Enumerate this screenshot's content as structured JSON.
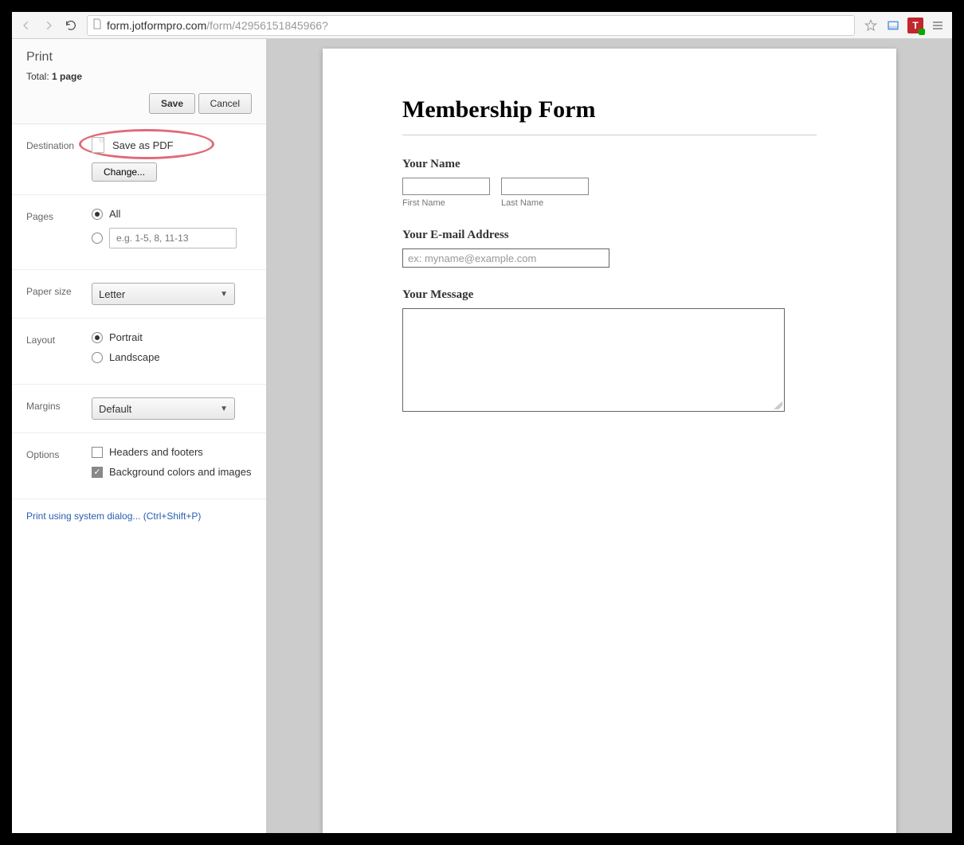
{
  "browser": {
    "url_host": "form.jotformpro.com",
    "url_path": "/form/42956151845966?"
  },
  "print": {
    "title": "Print",
    "total_prefix": "Total: ",
    "total_value": "1 page",
    "save": "Save",
    "cancel": "Cancel",
    "sections": {
      "destination": {
        "label": "Destination",
        "value": "Save as PDF",
        "change": "Change..."
      },
      "pages": {
        "label": "Pages",
        "all": "All",
        "range_placeholder": "e.g. 1-5, 8, 11-13"
      },
      "paper": {
        "label": "Paper size",
        "value": "Letter"
      },
      "layout": {
        "label": "Layout",
        "portrait": "Portrait",
        "landscape": "Landscape"
      },
      "margins": {
        "label": "Margins",
        "value": "Default"
      },
      "options": {
        "label": "Options",
        "headers": "Headers and footers",
        "background": "Background colors and images"
      }
    },
    "system_link": "Print using system dialog... (Ctrl+Shift+P)"
  },
  "form": {
    "title": "Membership Form",
    "your_name": "Your Name",
    "first_name": "First Name",
    "last_name": "Last Name",
    "email_label": "Your E-mail Address",
    "email_placeholder": "ex: myname@example.com",
    "message_label": "Your Message"
  }
}
